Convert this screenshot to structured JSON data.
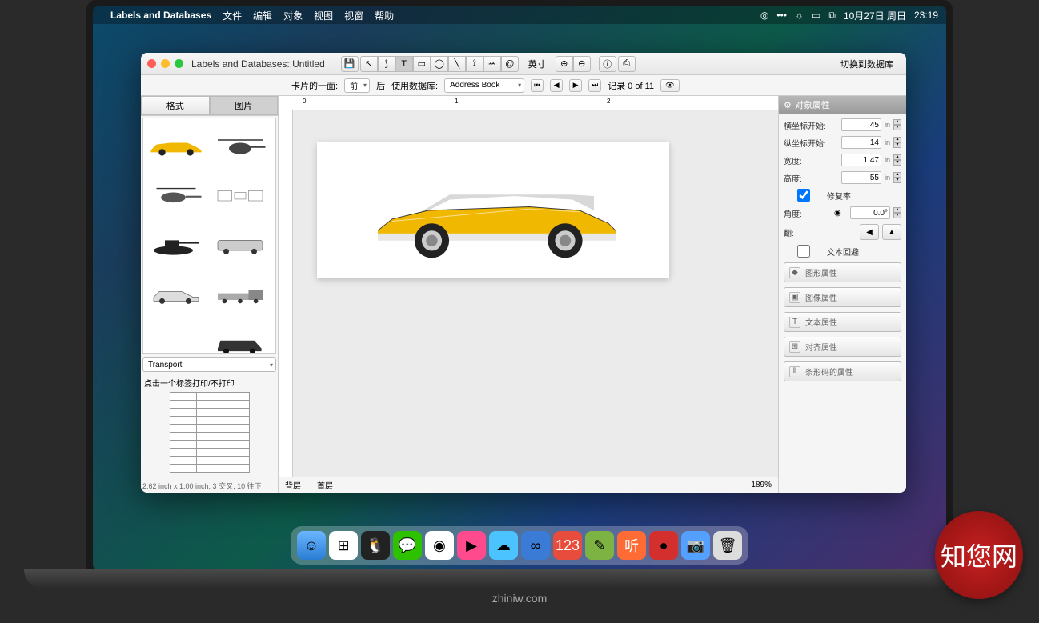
{
  "menubar": {
    "app": "Labels and Databases",
    "items": [
      "文件",
      "编辑",
      "对象",
      "视图",
      "视窗",
      "帮助"
    ],
    "date": "10月27日 周日",
    "time": "23:19"
  },
  "window": {
    "title": "Labels and  Databases::Untitled"
  },
  "toolbar": {
    "units": "英寸",
    "switch": "切换到数据库"
  },
  "subtoolbar": {
    "card_side": "卡片的一面:",
    "side_front": "前",
    "side_back": "后",
    "use_db": "使用数据库:",
    "db": "Address Book",
    "record": "记录 0 of 11"
  },
  "sidebar": {
    "tabs": [
      "格式",
      "图片"
    ],
    "category": "Transport",
    "print_hint": "点击一个标签打印/不打印",
    "dims": "2.62 inch x 1.00 inch, 3 交叉, 10 往下"
  },
  "canvas": {
    "layer_back": "背层",
    "layer_front": "首层",
    "zoom": "189%"
  },
  "inspector": {
    "title": "对象属性",
    "x_label": "横坐标开始:",
    "x_val": ".45",
    "x_unit": "in",
    "y_label": "纵坐标开始:",
    "y_val": ".14",
    "y_unit": "in",
    "w_label": "宽度:",
    "w_val": "1.47",
    "w_unit": "in",
    "h_label": "高度:",
    "h_val": ".55",
    "h_unit": "in",
    "keep_ratio": "修复率",
    "angle_label": "角度:",
    "angle_val": "0.0°",
    "flip_label": "翻:",
    "text_wrap": "文本回避",
    "panels": [
      "图形属性",
      "图像属性",
      "文本属性",
      "对齐属性",
      "条形码的属性"
    ]
  },
  "brand": "zhiniw.com",
  "watermark": "知您网"
}
